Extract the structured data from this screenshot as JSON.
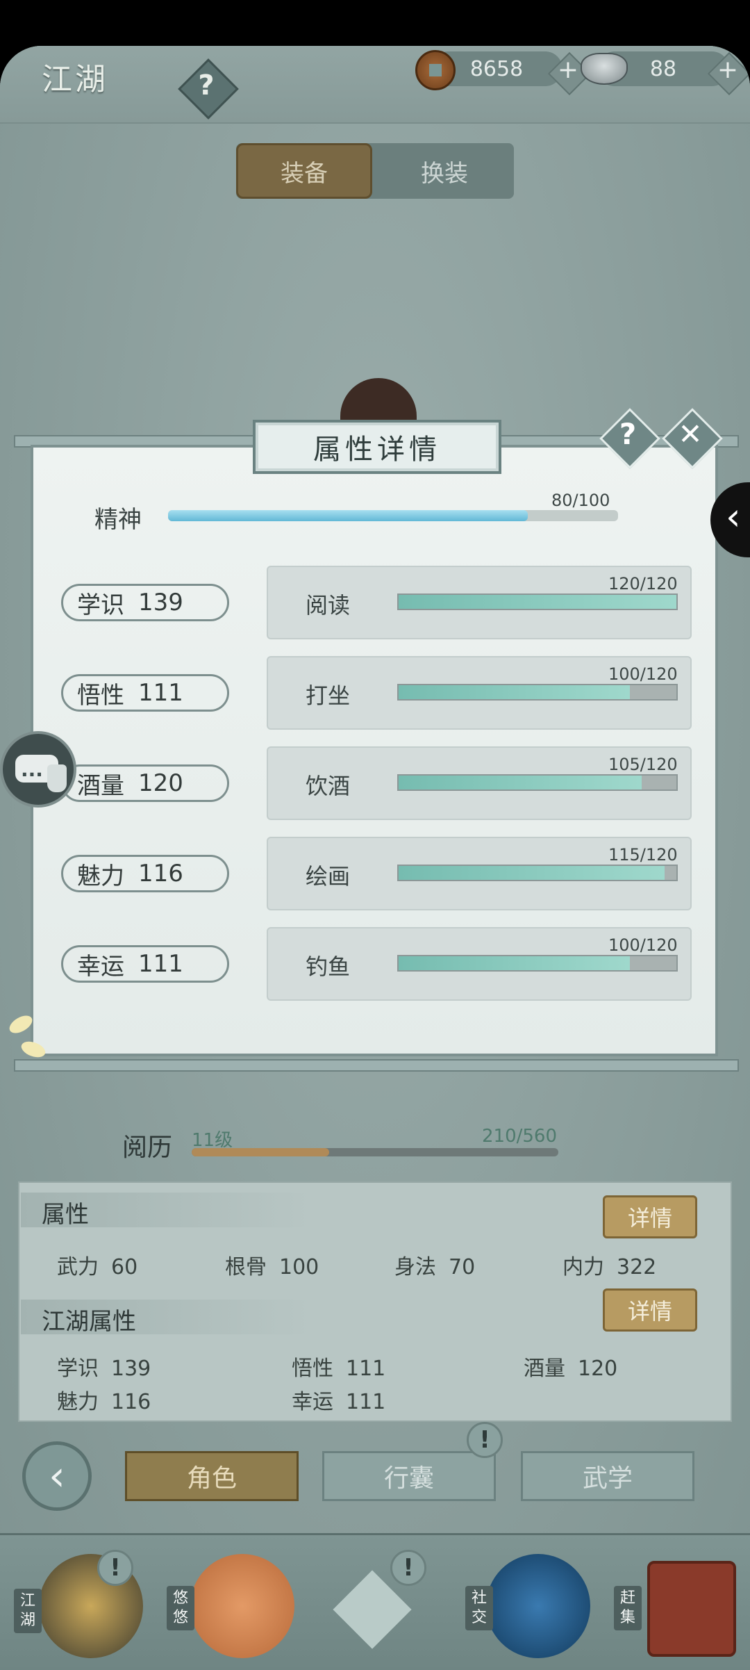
{
  "header": {
    "title": "江湖",
    "help_label": "?",
    "coins": "8658",
    "ingots": "88",
    "plus": "+"
  },
  "equip_tabs": {
    "equip": "装备",
    "swap": "换装"
  },
  "modal": {
    "title": "属性详情",
    "help": "?",
    "close": "✕",
    "spirit": {
      "label": "精神",
      "value_text": "80/100",
      "value": 80,
      "max": 100
    },
    "attributes": [
      {
        "name": "学识",
        "value": "139"
      },
      {
        "name": "悟性",
        "value": "111"
      },
      {
        "name": "酒量",
        "value": "120"
      },
      {
        "name": "魅力",
        "value": "116"
      },
      {
        "name": "幸运",
        "value": "111"
      }
    ],
    "skills": [
      {
        "name": "阅读",
        "value_text": "120/120",
        "value": 120,
        "max": 120
      },
      {
        "name": "打坐",
        "value_text": "100/120",
        "value": 100,
        "max": 120
      },
      {
        "name": "饮酒",
        "value_text": "105/120",
        "value": 105,
        "max": 120
      },
      {
        "name": "绘画",
        "value_text": "115/120",
        "value": 115,
        "max": 120
      },
      {
        "name": "钓鱼",
        "value_text": "100/120",
        "value": 100,
        "max": 120
      }
    ]
  },
  "experience": {
    "label": "阅历",
    "level": "11级",
    "value_text": "210/560",
    "value": 210,
    "max": 560
  },
  "attributes_section": {
    "title": "属性",
    "detail": "详情",
    "stats": [
      {
        "name": "武力",
        "value": "60"
      },
      {
        "name": "根骨",
        "value": "100"
      },
      {
        "name": "身法",
        "value": "70"
      },
      {
        "name": "内力",
        "value": "322"
      }
    ]
  },
  "jianghu_section": {
    "title": "江湖属性",
    "detail": "详情",
    "stats": [
      {
        "name": "学识",
        "value": "139"
      },
      {
        "name": "悟性",
        "value": "111"
      },
      {
        "name": "酒量",
        "value": "120"
      },
      {
        "name": "魅力",
        "value": "116"
      },
      {
        "name": "幸运",
        "value": "111"
      }
    ]
  },
  "nav": {
    "back": "‹",
    "character": "角色",
    "bag": "行囊",
    "martial": "武学",
    "alert": "!"
  },
  "bottom_nav": {
    "jianghu": "江湖",
    "youyou": "悠悠",
    "social": "社交",
    "market": "赶集"
  }
}
